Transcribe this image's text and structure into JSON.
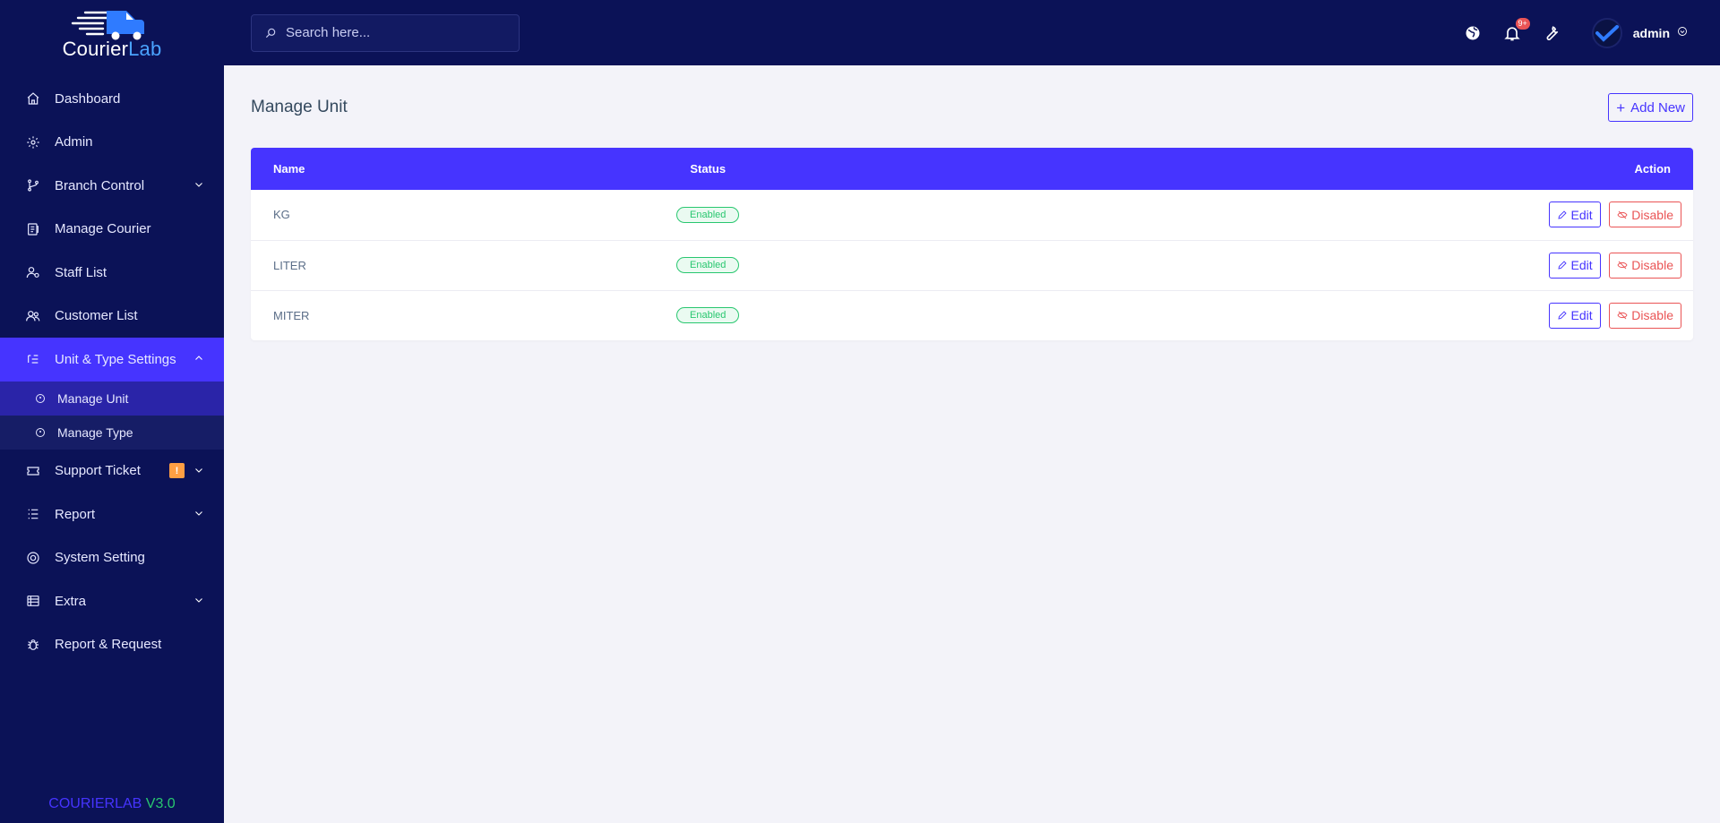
{
  "brand": {
    "logo_text_a": "Courier",
    "logo_text_b": "Lab",
    "version_a": "COURIERLAB",
    "version_b": "V3.0"
  },
  "search": {
    "placeholder": "Search here..."
  },
  "topbar": {
    "notification_count": "9+",
    "user_name": "admin"
  },
  "sidebar": {
    "items": [
      {
        "label": "Dashboard",
        "icon": "home-icon"
      },
      {
        "label": "Admin",
        "icon": "users-cog-icon"
      },
      {
        "label": "Branch Control",
        "icon": "branch-icon",
        "has_children": true
      },
      {
        "label": "Manage Courier",
        "icon": "courier-icon"
      },
      {
        "label": "Staff List",
        "icon": "staff-icon"
      },
      {
        "label": "Customer List",
        "icon": "customers-icon"
      },
      {
        "label": "Unit & Type Settings",
        "icon": "list-settings-icon",
        "expanded": true,
        "active": true
      },
      {
        "label": "Support Ticket",
        "icon": "ticket-icon",
        "badge": "!",
        "has_children": true
      },
      {
        "label": "Report",
        "icon": "report-list-icon",
        "has_children": true
      },
      {
        "label": "System Setting",
        "icon": "life-ring-icon"
      },
      {
        "label": "Extra",
        "icon": "server-icon",
        "has_children": true
      },
      {
        "label": "Report & Request",
        "icon": "bug-icon"
      }
    ],
    "sub_items": [
      {
        "label": "Manage Unit",
        "active": true
      },
      {
        "label": "Manage Type",
        "active": false
      }
    ]
  },
  "page": {
    "title": "Manage Unit",
    "add_button": "Add New"
  },
  "table": {
    "columns": [
      "Name",
      "Status",
      "Action"
    ],
    "rows": [
      {
        "name": "KG",
        "status": "Enabled",
        "edit": "Edit",
        "disable": "Disable"
      },
      {
        "name": "LITER",
        "status": "Enabled",
        "edit": "Edit",
        "disable": "Disable"
      },
      {
        "name": "MITER",
        "status": "Enabled",
        "edit": "Edit",
        "disable": "Disable"
      }
    ]
  },
  "colors": {
    "sidebar_bg": "#0b1257",
    "accent": "#4634ff",
    "success": "#28c76f",
    "danger": "#ea5455",
    "warning": "#ff9f43"
  }
}
